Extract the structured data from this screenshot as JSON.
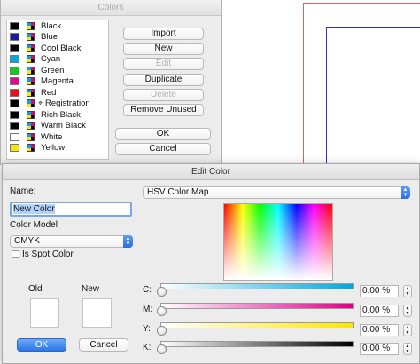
{
  "colors_window": {
    "title": "Colors",
    "items": [
      {
        "name": "Black",
        "swatch": "#000000",
        "icon": "cmyk-icon"
      },
      {
        "name": "Blue",
        "swatch": "#1a1aa0",
        "icon": "cmyk-icon"
      },
      {
        "name": "Cool Black",
        "swatch": "#000000",
        "icon": "cmyk-icon"
      },
      {
        "name": "Cyan",
        "swatch": "#0aa7dc",
        "icon": "cmyk-icon"
      },
      {
        "name": "Green",
        "swatch": "#19c81e",
        "icon": "cmyk-icon"
      },
      {
        "name": "Magenta",
        "swatch": "#e0088c",
        "icon": "cmyk-icon"
      },
      {
        "name": "Red",
        "swatch": "#e8101e",
        "icon": "cmyk-icon"
      },
      {
        "name": "Registration",
        "swatch": "#000000",
        "icon": "registration-icon"
      },
      {
        "name": "Rich Black",
        "swatch": "#000000",
        "icon": "cmyk-icon"
      },
      {
        "name": "Warm Black",
        "swatch": "#000000",
        "icon": "cmyk-icon"
      },
      {
        "name": "White",
        "swatch": "#ffffff",
        "icon": "cmyk-icon"
      },
      {
        "name": "Yellow",
        "swatch": "#f5e60a",
        "icon": "cmyk-icon"
      }
    ],
    "buttons": {
      "import": "Import",
      "new": "New",
      "edit": "Edit",
      "duplicate": "Duplicate",
      "delete": "Delete",
      "remove_unused": "Remove Unused",
      "ok": "OK",
      "cancel": "Cancel"
    }
  },
  "edit_color": {
    "title": "Edit Color",
    "name_label": "Name:",
    "name_value": "New Color",
    "color_model_label": "Color Model",
    "color_model_value": "CMYK",
    "spot_color_label": "Is Spot Color",
    "spot_color_checked": false,
    "old_label": "Old",
    "new_label": "New",
    "ok": "OK",
    "cancel": "Cancel",
    "map_select_value": "HSV Color Map",
    "sliders": [
      {
        "label": "C:",
        "value": "0.00 %",
        "color": "#00a8e0"
      },
      {
        "label": "M:",
        "value": "0.00 %",
        "color": "#e0008c"
      },
      {
        "label": "Y:",
        "value": "0.00 %",
        "color": "#ffe600"
      },
      {
        "label": "K:",
        "value": "0.00 %",
        "color": "#000000"
      }
    ],
    "accent_color": "#2d76e4"
  }
}
